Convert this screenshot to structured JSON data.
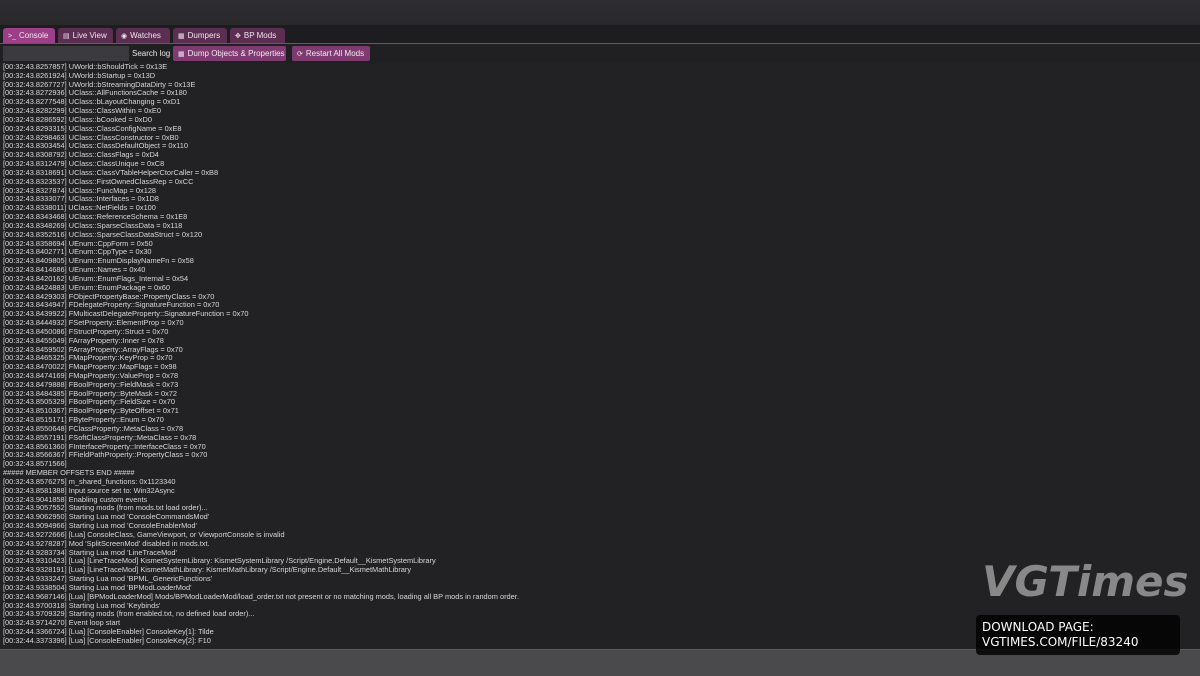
{
  "tabs": [
    {
      "icon": ">_",
      "label": "Console",
      "active": true
    },
    {
      "icon": "▤",
      "label": "Live View",
      "active": false
    },
    {
      "icon": "◉",
      "label": "Watches",
      "active": false
    },
    {
      "icon": "▦",
      "label": "Dumpers",
      "active": false
    },
    {
      "icon": "✥",
      "label": "BP Mods",
      "active": false
    }
  ],
  "toolbar": {
    "search_value": "",
    "search_label": "Search log",
    "dump_icon": "▦",
    "dump_label": "Dump Objects & Properties",
    "restart_icon": "⟳",
    "restart_label": "Restart All Mods"
  },
  "log_lines": [
    "[00:32:43.8257857] UWorld::bShouldTick = 0x13E",
    "[00:32:43.8261924] UWorld::bStartup = 0x13D",
    "[00:32:43.8267727] UWorld::bStreamingDataDirty = 0x13E",
    "[00:32:43.8272936] UClass::AllFunctionsCache = 0x180",
    "[00:32:43.8277548] UClass::bLayoutChanging = 0xD1",
    "[00:32:43.8282299] UClass::ClassWithin = 0xE0",
    "[00:32:43.8286592] UClass::bCooked = 0xD0",
    "[00:32:43.8293315] UClass::ClassConfigName = 0xE8",
    "[00:32:43.8298463] UClass::ClassConstructor = 0xB0",
    "[00:32:43.8303454] UClass::ClassDefaultObject = 0x110",
    "[00:32:43.8308792] UClass::ClassFlags = 0xD4",
    "[00:32:43.8312479] UClass::ClassUnique = 0xC8",
    "[00:32:43.8318691] UClass::ClassVTableHelperCtorCaller = 0xB8",
    "[00:32:43.8323537] UClass::FirstOwnedClassRep = 0xCC",
    "[00:32:43.8327874] UClass::FuncMap = 0x128",
    "[00:32:43.8333077] UClass::Interfaces = 0x1D8",
    "[00:32:43.8338011] UClass::NetFields = 0x100",
    "[00:32:43.8343468] UClass::ReferenceSchema = 0x1E8",
    "[00:32:43.8348269] UClass::SparseClassData = 0x118",
    "[00:32:43.8352516] UClass::SparseClassDataStruct = 0x120",
    "[00:32:43.8358694] UEnum::CppForm = 0x50",
    "[00:32:43.8402771] UEnum::CppType = 0x30",
    "[00:32:43.8409805] UEnum::EnumDisplayNameFn = 0x58",
    "[00:32:43.8414686] UEnum::Names = 0x40",
    "[00:32:43.8420162] UEnum::EnumFlags_Internal = 0x54",
    "[00:32:43.8424883] UEnum::EnumPackage = 0x60",
    "[00:32:43.8429303] FObjectPropertyBase::PropertyClass = 0x70",
    "[00:32:43.8434947] FDelegateProperty::SignatureFunction = 0x70",
    "[00:32:43.8439922] FMulticastDelegateProperty::SignatureFunction = 0x70",
    "[00:32:43.8444932] FSetProperty::ElementProp = 0x70",
    "[00:32:43.8450086] FStructProperty::Struct = 0x70",
    "[00:32:43.8455049] FArrayProperty::Inner = 0x78",
    "[00:32:43.8459502] FArrayProperty::ArrayFlags = 0x70",
    "[00:32:43.8465325] FMapProperty::KeyProp = 0x70",
    "[00:32:43.8470022] FMapProperty::MapFlags = 0x98",
    "[00:32:43.8474169] FMapProperty::ValueProp = 0x78",
    "[00:32:43.8479888] FBoolProperty::FieldMask = 0x73",
    "[00:32:43.8484385] FBoolProperty::ByteMask = 0x72",
    "[00:32:43.8505329] FBoolProperty::FieldSize = 0x70",
    "[00:32:43.8510367] FBoolProperty::ByteOffset = 0x71",
    "[00:32:43.8515171] FByteProperty::Enum = 0x70",
    "[00:32:43.8550648] FClassProperty::MetaClass = 0x78",
    "[00:32:43.8557191] FSoftClassProperty::MetaClass = 0x78",
    "[00:32:43.8561360] FInterfaceProperty::InterfaceClass = 0x70",
    "[00:32:43.8566367] FFieldPathProperty::PropertyClass = 0x70",
    "[00:32:43.8571566]",
    "##### MEMBER OFFSETS END #####",
    "[00:32:43.8576275] m_shared_functions: 0x1123340",
    "[00:32:43.8581388] Input source set to: Win32Async",
    "[00:32:43.9041858] Enabling custom events",
    "[00:32:43.9057552] Starting mods (from mods.txt load order)...",
    "[00:32:43.9062950] Starting Lua mod 'ConsoleCommandsMod'",
    "[00:32:43.9094966] Starting Lua mod 'ConsoleEnablerMod'",
    "[00:32:43.9272666] [Lua] ConsoleClass, GameViewport, or ViewportConsole is invalid",
    "[00:32:43.9278287] Mod 'SplitScreenMod' disabled in mods.txt.",
    "[00:32:43.9283734] Starting Lua mod 'LineTraceMod'",
    "[00:32:43.9310423] [Lua] [LineTraceMod] KismetSystemLibrary: KismetSystemLibrary /Script/Engine.Default__KismetSystemLibrary",
    "[00:32:43.9328191] [Lua] [LineTraceMod] KismetMathLibrary: KismetMathLibrary /Script/Engine.Default__KismetMathLibrary",
    "[00:32:43.9333247] Starting Lua mod 'BPML_GenericFunctions'",
    "[00:32:43.9338504] Starting Lua mod 'BPModLoaderMod'",
    "[00:32:43.9687146] [Lua] [BPModLoaderMod] Mods/BPModLoaderMod/load_order.txt not present or no matching mods, loading all BP mods in random order.",
    "[00:32:43.9700318] Starting Lua mod 'Keybinds'",
    "[00:32:43.9709329] Starting mods (from enabled.txt, no defined load order)...",
    "[00:32:43.9714270] Event loop start",
    "[00:32:44.3366724] [Lua] [ConsoleEnabler] ConsoleKey[1]: Tilde",
    "[00:32:44.3373396] [Lua] [ConsoleEnabler] ConsoleKey[2]: F10"
  ],
  "watermark": {
    "logo": "VGTimes",
    "download_label": "DOWNLOAD PAGE:",
    "download_url": "VGTIMES.COM/FILE/83240"
  }
}
